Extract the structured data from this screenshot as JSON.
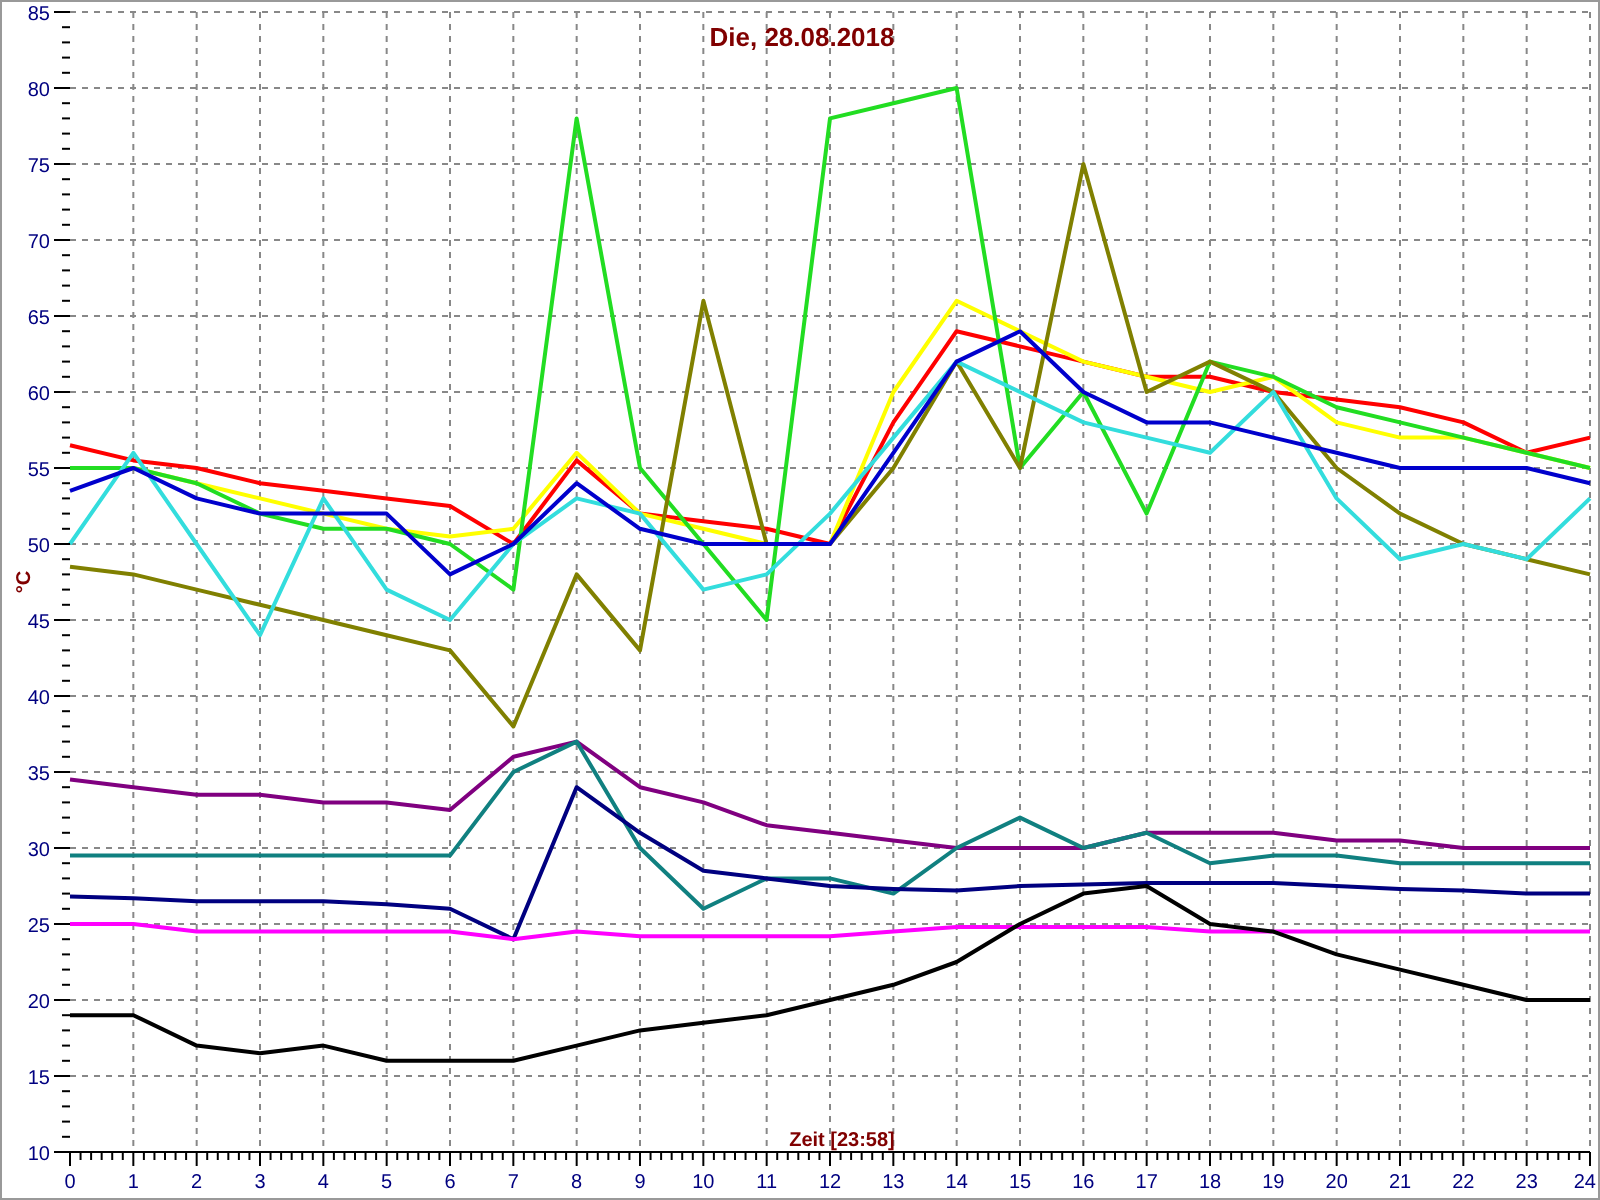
{
  "chart_data": {
    "type": "line",
    "title": "Die, 28.08.2018",
    "xlabel": "Zeit [23:58]",
    "ylabel": "°C",
    "x": [
      0,
      1,
      2,
      3,
      4,
      5,
      6,
      7,
      8,
      9,
      10,
      11,
      12,
      13,
      14,
      15,
      16,
      17,
      18,
      19,
      20,
      21,
      22,
      23,
      24
    ],
    "series": [
      {
        "color": "#ff0000",
        "values": [
          56.5,
          55.5,
          55,
          54,
          53.5,
          53,
          52.5,
          50,
          55.5,
          52,
          51.5,
          51,
          50,
          58,
          64,
          63,
          62,
          61,
          61,
          60,
          59.5,
          59,
          58,
          56,
          57
        ]
      },
      {
        "color": "#ffff00",
        "values": [
          55,
          55,
          54,
          53,
          52,
          51,
          50.5,
          51,
          56,
          52,
          51,
          50,
          50,
          60,
          66,
          64,
          62,
          61,
          60,
          61,
          58,
          57,
          57,
          56,
          55
        ]
      },
      {
        "color": "#22dd22",
        "values": [
          55,
          55,
          54,
          52,
          51,
          51,
          50,
          47,
          78,
          55,
          50,
          45,
          78,
          79,
          80,
          55,
          60,
          52,
          62,
          61,
          59,
          58,
          57,
          56,
          55
        ]
      },
      {
        "color": "#808000",
        "values": [
          48.5,
          48,
          47,
          46,
          45,
          44,
          43,
          38,
          48,
          43,
          66,
          50,
          50,
          55,
          62,
          55,
          75,
          60,
          62,
          60,
          55,
          52,
          50,
          49,
          48
        ]
      },
      {
        "color": "#33dddd",
        "values": [
          50,
          56,
          50,
          44,
          53,
          47,
          45,
          50,
          53,
          52,
          47,
          48,
          52,
          57,
          62,
          60,
          58,
          57,
          56,
          60,
          53,
          49,
          50,
          49,
          53
        ]
      },
      {
        "color": "#0000cc",
        "values": [
          53.5,
          55,
          53,
          52,
          52,
          52,
          48,
          50,
          54,
          51,
          50,
          50,
          50,
          56,
          62,
          64,
          60,
          58,
          58,
          57,
          56,
          55,
          55,
          55,
          54
        ]
      },
      {
        "color": "#800080",
        "values": [
          34.5,
          34,
          33.5,
          33.5,
          33,
          33,
          32.5,
          36,
          37,
          34,
          33,
          31.5,
          31,
          30.5,
          30,
          30,
          30,
          31,
          31,
          31,
          30.5,
          30.5,
          30,
          30,
          30
        ]
      },
      {
        "color": "#108080",
        "values": [
          29.5,
          29.5,
          29.5,
          29.5,
          29.5,
          29.5,
          29.5,
          35,
          37,
          30,
          26,
          28,
          28,
          27,
          30,
          32,
          30,
          31,
          29,
          29.5,
          29.5,
          29,
          29,
          29,
          29
        ]
      },
      {
        "color": "#000080",
        "values": [
          26.8,
          26.7,
          26.5,
          26.5,
          26.5,
          26.3,
          26,
          24,
          34,
          31,
          28.5,
          28,
          27.5,
          27.3,
          27.2,
          27.5,
          27.6,
          27.7,
          27.7,
          27.7,
          27.5,
          27.3,
          27.2,
          27,
          27
        ]
      },
      {
        "color": "#ff00ff",
        "values": [
          25,
          25,
          24.5,
          24.5,
          24.5,
          24.5,
          24.5,
          24,
          24.5,
          24.2,
          24.2,
          24.2,
          24.2,
          24.5,
          24.8,
          24.8,
          24.8,
          24.8,
          24.5,
          24.5,
          24.5,
          24.5,
          24.5,
          24.5,
          24.5
        ]
      },
      {
        "color": "#000000",
        "values": [
          19,
          19,
          17,
          16.5,
          17,
          16,
          16,
          16,
          17,
          18,
          18.5,
          19,
          20,
          21,
          22.5,
          25,
          27,
          27.5,
          25,
          24.5,
          23,
          22,
          21,
          20,
          20
        ]
      }
    ],
    "grid": true,
    "xlim": [
      0,
      24
    ],
    "ylim": [
      10,
      85
    ],
    "xticks": [
      0,
      1,
      2,
      3,
      4,
      5,
      6,
      7,
      8,
      9,
      10,
      11,
      12,
      13,
      14,
      15,
      16,
      17,
      18,
      19,
      20,
      21,
      22,
      23,
      24
    ],
    "yticks": [
      10,
      15,
      20,
      25,
      30,
      35,
      40,
      45,
      50,
      55,
      60,
      65,
      70,
      75,
      80,
      85
    ]
  }
}
